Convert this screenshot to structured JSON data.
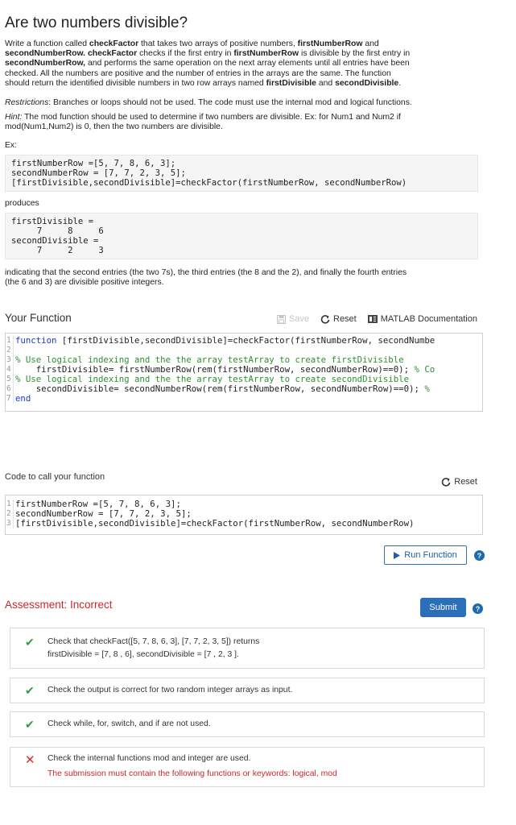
{
  "problem": {
    "title": "Are two numbers divisible?",
    "desc": {
      "p1": "Write a function called ",
      "b1": "checkFactor",
      "p2": " that takes two arrays of positive numbers, ",
      "b2": "firstNumberRow",
      "p3": " and",
      "b3": "secondNumberRow.",
      "p4": " ",
      "b4": "checkFactor",
      "p5": " checks if the first entry in ",
      "b5": "firstNumberRow",
      "p6": " is divisible by the first entry in",
      "b6": "secondNumberRow,",
      "p7": " and performs the same operation on the next array elements until all entries have been",
      "p8": "checked.  All the numbers are positive and the number of entries in the arrays are the same. The function",
      "p9": "should return the identified divisible numbers in two row arrays named ",
      "b7": "firstDivisible",
      "p10": " and ",
      "b8": "secondDivisible",
      "p11": "."
    },
    "restrictions_label": "Restrictions",
    "restrictions_text": ": Branches or loops should not be used.  The code must use the internal mod and logical functions.",
    "hint_label": "Hint:",
    "hint_text1": " The mod function should be used to determine if two numbers are divisible. Ex: for Num1 and Num2 if",
    "hint_text2": "mod(Num1,Num2) is 0, then the two numbers are divisible.",
    "ex_label": "Ex:",
    "example_code": [
      "firstNumberRow =[5, 7, 8, 6, 3];",
      "secondNumberRow = [7, 7, 2, 3, 5];",
      "[firstDivisible,secondDivisible]=checkFactor(firstNumberRow, secondNumberRow)"
    ],
    "produces_label": "produces",
    "output_code": [
      "firstDivisible =",
      "     7     8     6",
      "secondDivisible =",
      "     7     2     3"
    ],
    "indicating1": "indicating that the second entries (the two 7s), the third entries (the 8 and the 2), and finally the fourth entries",
    "indicating2": "(the 6 and 3) are divisible positive integers."
  },
  "your_function": {
    "title": "Your Function",
    "save_label": "Save",
    "reset_label": "Reset",
    "docs_label": "MATLAB Documentation",
    "lines": [
      {
        "num": "1",
        "kw": "function",
        "text": " [firstDivisible,secondDivisible]=checkFactor(firstNumberRow, secondNumbe",
        "cm": ""
      },
      {
        "num": "2",
        "kw": "",
        "text": "",
        "cm": ""
      },
      {
        "num": "3",
        "kw": "",
        "text": "",
        "cm": "% Use logical indexing and the the array testArray to create firstDivisible"
      },
      {
        "num": "4",
        "kw": "",
        "text": "    firstDivisible= firstNumberRow(rem(firstNumberRow, secondNumberRow)==0); ",
        "cm": "% Co"
      },
      {
        "num": "5",
        "kw": "",
        "text": "",
        "cm": "% Use logical indexing and the the array testArray to create secondDivisible"
      },
      {
        "num": "6",
        "kw": "",
        "text": "    secondDivisible= secondNumberRow(rem(firstNumberRow, secondNumberRow)==0); ",
        "cm": "%"
      },
      {
        "num": "7",
        "kw": "end",
        "text": "",
        "cm": ""
      }
    ]
  },
  "call_function": {
    "title": "Code to call your function",
    "reset_label": "Reset",
    "lines": [
      {
        "num": "1",
        "text": "firstNumberRow =[5, 7, 8, 6, 3];"
      },
      {
        "num": "2",
        "text": "secondNumberRow = [7, 7, 2, 3, 5];"
      },
      {
        "num": "3",
        "text": "[firstDivisible,secondDivisible]=checkFactor(firstNumberRow, secondNumberRow)"
      }
    ],
    "run_label": "Run Function"
  },
  "assessment": {
    "title": "Assessment: Incorrect",
    "submit_label": "Submit",
    "checks": [
      {
        "status": "pass",
        "line1": "Check that checkFact([5, 7, 8, 6, 3], [7, 7, 2, 3, 5]) returns",
        "line2": "firstDivisible = [7, 8 , 6], secondDivisible = [7 , 2, 3 ]."
      },
      {
        "status": "pass",
        "line1": "Check the output is correct for two random integer arrays as input."
      },
      {
        "status": "pass",
        "line1": "Check while, for, switch, and if are not used."
      },
      {
        "status": "fail",
        "line1": "Check the internal functions mod and integer are used.",
        "error": "The submission must contain the following functions or keywords: logical, mod"
      }
    ]
  },
  "icons": {
    "save": "save-icon",
    "reset": "reset-icon",
    "docs": "documentation-icon",
    "run": "play-icon",
    "help": "help-icon",
    "pass": "checkmark-icon",
    "fail": "x-icon"
  },
  "colors": {
    "incorrect": "#c8292b",
    "pass": "#2e9e3e",
    "fail": "#d32f2f",
    "button_blue": "#2a6fb7"
  }
}
